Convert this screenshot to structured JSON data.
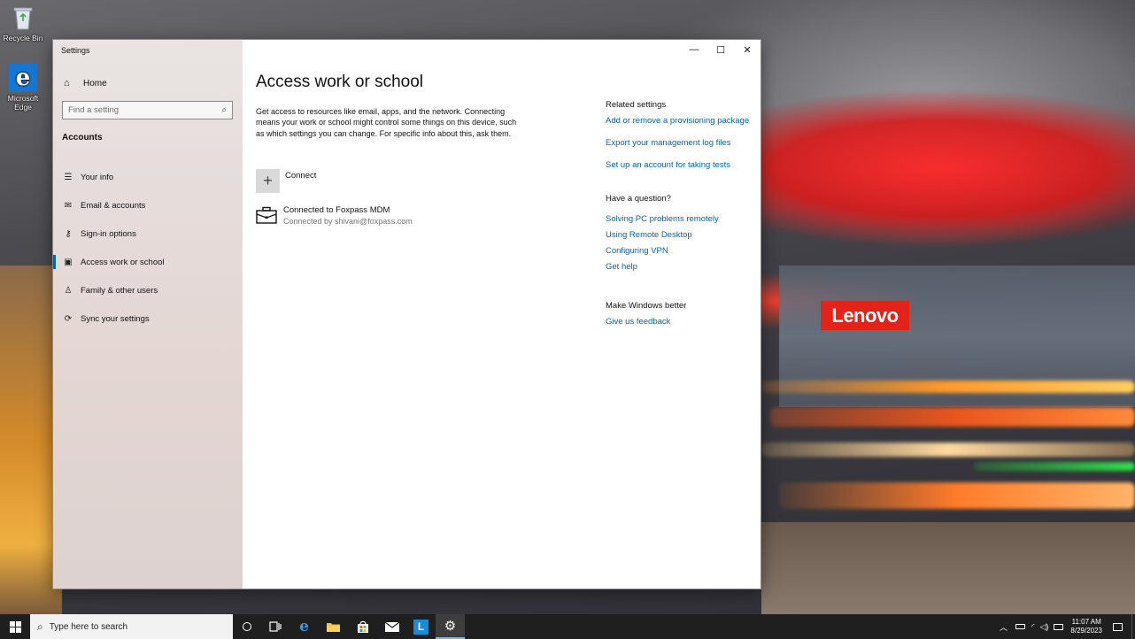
{
  "desktop": {
    "icons": [
      {
        "label": "Recycle Bin"
      },
      {
        "label": "Microsoft Edge"
      }
    ],
    "wallpaper_brand": "Lenovo"
  },
  "window": {
    "title": "Settings",
    "controls": {
      "minimize": "—",
      "maximize": "☐",
      "close": "✕"
    }
  },
  "sidebar": {
    "home_label": "Home",
    "search_placeholder": "Find a setting",
    "section": "Accounts",
    "items": [
      {
        "label": "Your info",
        "icon": "contact-card-icon",
        "glyph": "☰"
      },
      {
        "label": "Email & accounts",
        "icon": "mail-icon",
        "glyph": "✉"
      },
      {
        "label": "Sign-in options",
        "icon": "key-icon",
        "glyph": "⚷"
      },
      {
        "label": "Access work or school",
        "icon": "briefcase-icon",
        "glyph": "▣",
        "active": true
      },
      {
        "label": "Family & other users",
        "icon": "person-icon",
        "glyph": "♙"
      },
      {
        "label": "Sync your settings",
        "icon": "sync-icon",
        "glyph": "⟳"
      }
    ]
  },
  "main": {
    "title": "Access work or school",
    "intro": "Get access to resources like email, apps, and the network. Connecting means your work or school might control some things on this device, such as which settings you can change. For specific info about this, ask them.",
    "connect_label": "Connect",
    "account": {
      "name": "Connected to Foxpass MDM",
      "detail": "Connected by shivani@foxpass.com"
    }
  },
  "related": {
    "heading": "Related settings",
    "links": [
      "Add or remove a provisioning package",
      "Export your management log files",
      "Set up an account for taking tests"
    ],
    "question_heading": "Have a question?",
    "question_links": [
      "Solving PC problems remotely",
      "Using Remote Desktop",
      "Configuring VPN",
      "Get help"
    ],
    "better_heading": "Make Windows better",
    "feedback_link": "Give us feedback"
  },
  "taskbar": {
    "search_placeholder": "Type here to search",
    "time": "11:07 AM",
    "date": "8/29/2023"
  },
  "colors": {
    "accent": "#0063b1",
    "taskbar": "#1f1f1f",
    "lenovo_red": "#e2231a"
  }
}
